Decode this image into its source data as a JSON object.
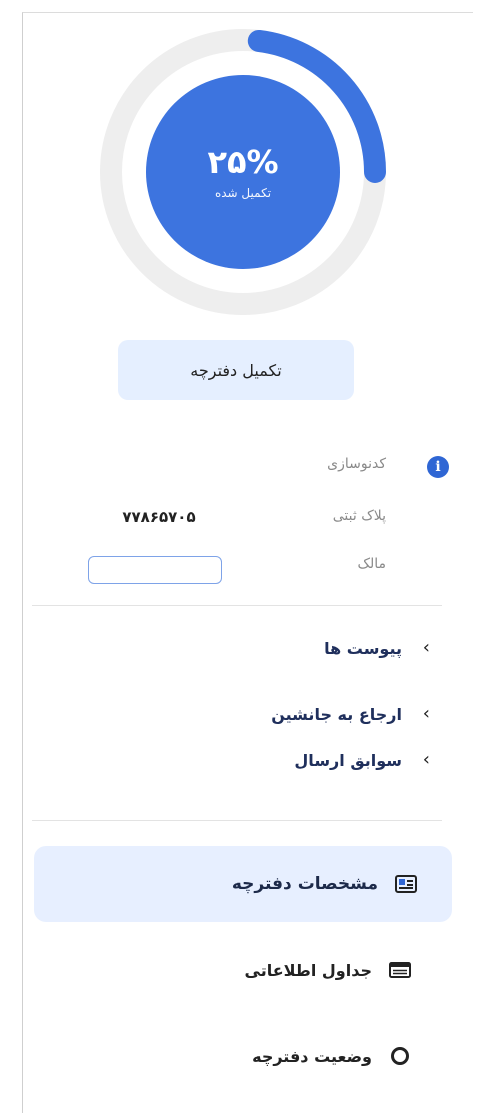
{
  "progress": {
    "percent_text": "۲۵%",
    "caption": "تکمیل شده",
    "value_fraction": 0.25,
    "track_color": "#eeeeee",
    "fill_color": "#3d74df"
  },
  "complete_button": {
    "label": "تکمیل دفترچه"
  },
  "details": {
    "icon": "info-icon",
    "customization_label": "کدنوسازی",
    "plate_label": "پلاک ثبتی",
    "plate_value": "۷۷۸۶۵۷۰۵",
    "owner_label": "مالک",
    "owner_value": ""
  },
  "links": [
    {
      "label": "پیوست ها",
      "icon": "chevron-right-icon"
    },
    {
      "label": "ارجاع به جانشین",
      "icon": "chevron-right-icon"
    },
    {
      "label": "سوابق ارسال",
      "icon": "chevron-right-icon"
    }
  ],
  "nav": [
    {
      "label": "مشخصات دفترچه",
      "icon": "id-card-icon",
      "active": true
    },
    {
      "label": "جداول اطلاعاتی",
      "icon": "table-icon",
      "active": false
    },
    {
      "label": "وضعیت دفترچه",
      "icon": "status-ring-icon",
      "active": false
    }
  ],
  "colors": {
    "accent": "#2f66d4",
    "active_bg": "#e7efff",
    "button_bg": "#e5efff",
    "input_border": "#7ea3e8"
  }
}
